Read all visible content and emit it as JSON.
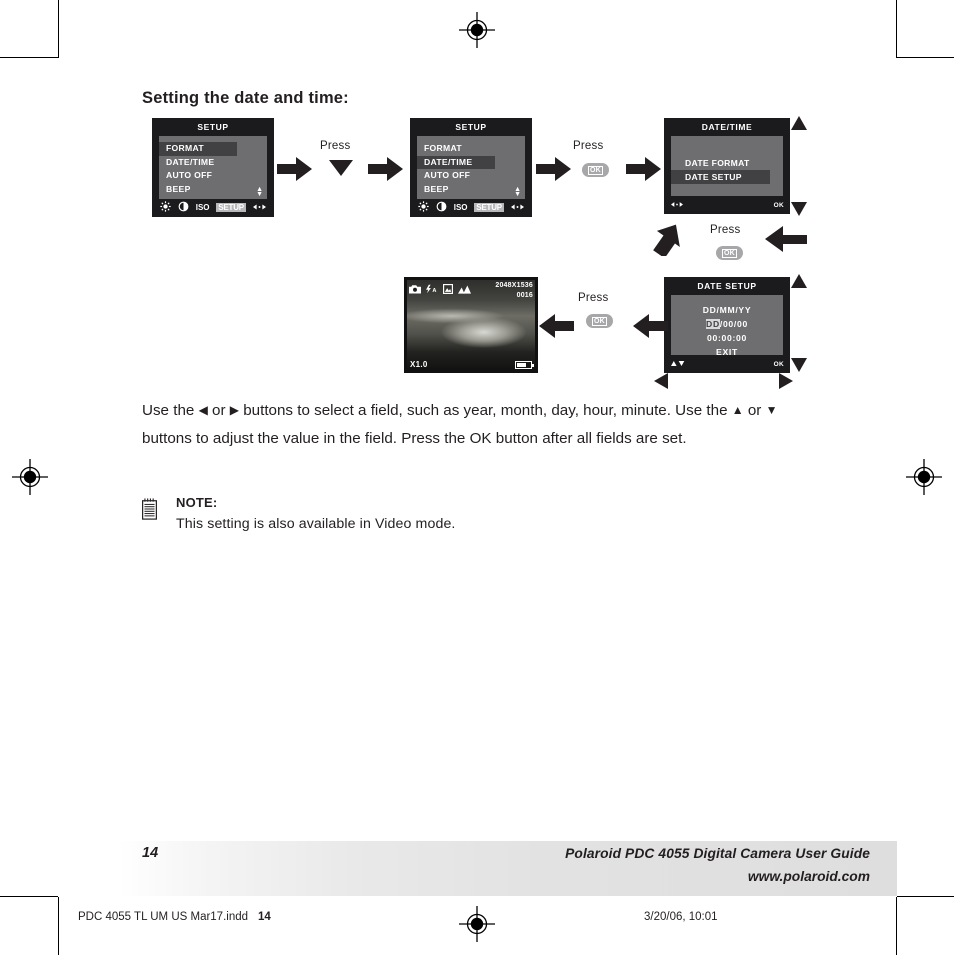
{
  "heading": "Setting the date and time:",
  "screens": {
    "setup1": {
      "title": "SETUP",
      "items": [
        "FORMAT",
        "DATE/TIME",
        "AUTO OFF",
        "BEEP"
      ],
      "selected": "FORMAT",
      "iconbar": [
        "brightness-icon",
        "contrast-icon",
        "ISO",
        "SETUP",
        "leftright-icon"
      ],
      "iconbar_active": "SETUP",
      "scroll_indicator": "up-down-arrows"
    },
    "setup2": {
      "title": "SETUP",
      "items": [
        "FORMAT",
        "DATE/TIME",
        "AUTO OFF",
        "BEEP"
      ],
      "selected": "DATE/TIME",
      "iconbar": [
        "brightness-icon",
        "contrast-icon",
        "ISO",
        "SETUP",
        "leftright-icon"
      ],
      "iconbar_active": "SETUP",
      "scroll_indicator": "up-down-arrows"
    },
    "datetime": {
      "title": "DATE/TIME",
      "items": [
        "DATE FORMAT",
        "DATE SETUP"
      ],
      "selected": "DATE SETUP",
      "footer_left": "left-right-arrows",
      "footer_right": "OK"
    },
    "datesetup": {
      "title": "DATE SETUP",
      "format_line": "DD/MM/YY",
      "date_value_highlight": "DD",
      "date_value_rest": "/00/00",
      "time_value": "00:00:00",
      "exit_label": "EXIT",
      "footer_left": "up-down-arrows",
      "footer_right": "OK"
    },
    "preview": {
      "icons": [
        "camera-icon",
        "flash-auto-icon",
        "white-balance-icon",
        "landscape-icon"
      ],
      "flash_label": "A",
      "resolution": "2048X1536",
      "shots_remaining": "0016",
      "zoom_level": "X1.0",
      "battery": "battery-icon"
    }
  },
  "flow": {
    "press_1": {
      "label": "Press",
      "control": "down-arrow-button"
    },
    "press_2": {
      "label": "Press",
      "control": "OK"
    },
    "press_3": {
      "label": "Press",
      "control": "OK"
    },
    "press_4": {
      "label": "Press",
      "control": "OK"
    },
    "ok_label": "OK"
  },
  "body": {
    "line1_a": "Use the ",
    "left_tri": "◀",
    "line1_b": " or ",
    "right_tri": "▶",
    "line1_c": " buttons to select a field, such as year, month, day, hour,",
    "line2_a": "minute. Use the ",
    "up_tri": "▲",
    "line2_b": " or ",
    "down_tri": "▼",
    "line2_c": " buttons to adjust the value in the field. Press the",
    "line3": "OK button after all fields are set."
  },
  "note": {
    "icon": "note-pad-icon",
    "title": "NOTE:",
    "text": "This setting is also available in Video mode."
  },
  "footer": {
    "page_number": "14",
    "line1": "Polaroid PDC 4055 Digital Camera User Guide",
    "line2": "www.polaroid.com"
  },
  "print_slug": {
    "filename": "PDC 4055 TL UM US Mar17.indd",
    "overlap_page": "14",
    "registration": "registration-mark",
    "timestamp": "3/20/06, 10:01"
  },
  "colors": {
    "ink": "#231f20",
    "lcd_frame": "#1b1b1d",
    "lcd_panel": "#6e6e70",
    "lcd_selected": "#414143",
    "ok_button": "#a7a7aa"
  }
}
